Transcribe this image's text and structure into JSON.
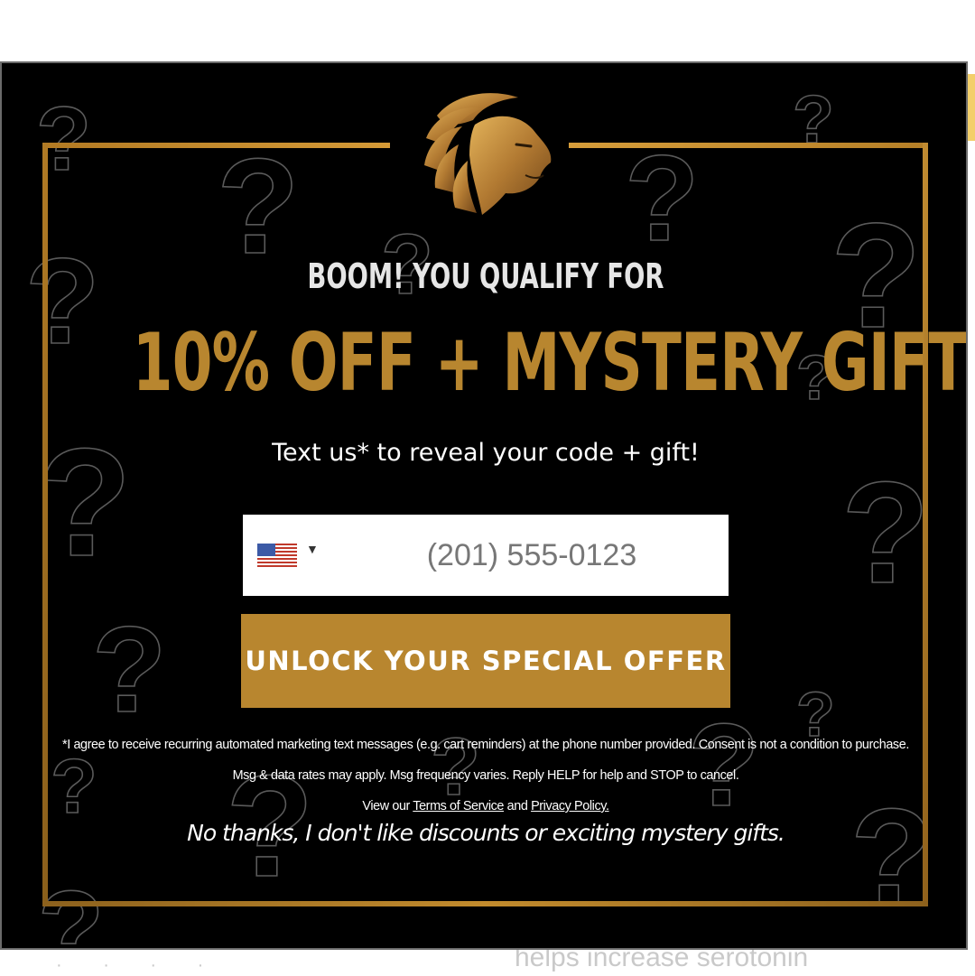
{
  "modal": {
    "eyebrow": "BOOM! YOU QUALIFY FOR",
    "headline": "10% OFF + MYSTERY GIFT",
    "subhead": "Text us* to reveal your code + gift!",
    "phone": {
      "country_flag": "US",
      "placeholder": "(201) 555-0123"
    },
    "cta_label": "UNLOCK YOUR SPECIAL OFFER",
    "legal_text": "*I agree to receive recurring automated marketing text messages (e.g. cart reminders) at the phone number provided. Consent is not a condition to purchase. Msg & data rates may apply. Msg frequency varies. Reply HELP for help and STOP to cancel.",
    "legal_view_our": "View our",
    "terms_link": "Terms of Service",
    "legal_and": "and",
    "privacy_link": "Privacy Policy.",
    "no_thanks": "No thanks, I don't like discounts or exciting mystery gifts."
  },
  "background_page": {
    "snippet": "helps increase serotonin"
  },
  "colors": {
    "gold": "#b8862f",
    "modal_bg": "#000000",
    "text": "#ffffff"
  },
  "icons": [
    "lion-logo-icon",
    "us-flag-icon",
    "caret-down-icon",
    "question-mark-icon"
  ]
}
